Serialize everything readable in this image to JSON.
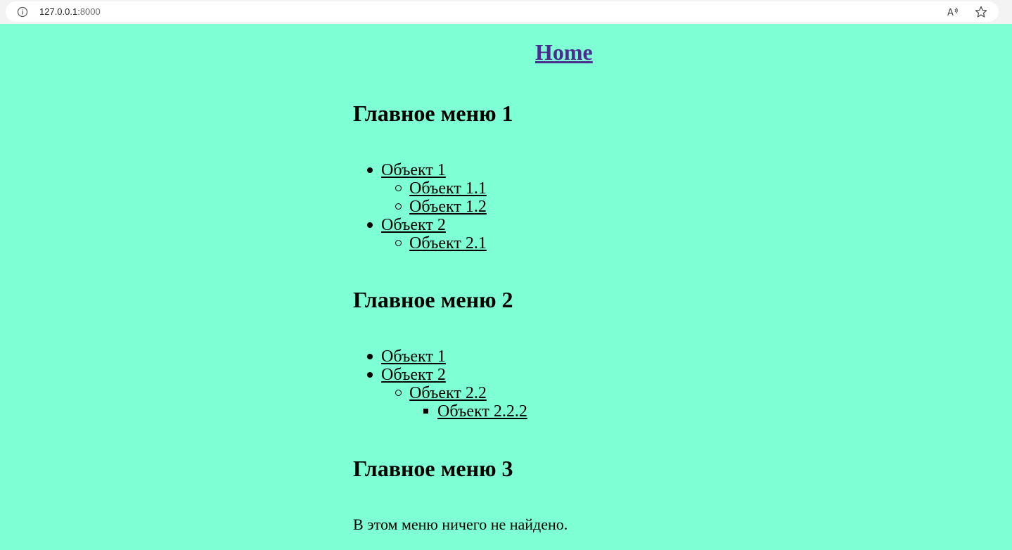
{
  "browser": {
    "url_host": "127.0.0.1:",
    "url_port": "8000"
  },
  "page": {
    "home_link": "Home",
    "menus": [
      {
        "title": "Главное меню 1",
        "items": [
          {
            "label": "Объект 1",
            "children": [
              {
                "label": "Объект 1.1"
              },
              {
                "label": "Объект 1.2"
              }
            ]
          },
          {
            "label": "Объект 2",
            "children": [
              {
                "label": "Объект 2.1"
              }
            ]
          }
        ]
      },
      {
        "title": "Главное меню 2",
        "items": [
          {
            "label": "Объект 1"
          },
          {
            "label": "Объект 2",
            "children": [
              {
                "label": "Объект 2.2",
                "children": [
                  {
                    "label": "Объект 2.2.2"
                  }
                ]
              }
            ]
          }
        ]
      },
      {
        "title": "Главное меню 3",
        "empty_message": "В этом меню ничего не найдено."
      }
    ]
  },
  "colors": {
    "background": "#7fffd4",
    "visited_link": "#4b2c8f"
  }
}
